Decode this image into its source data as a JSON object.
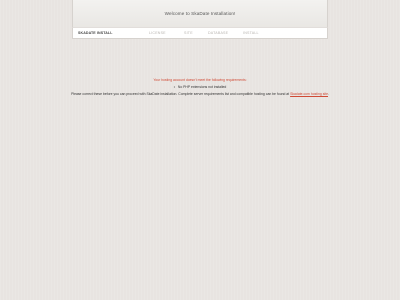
{
  "header": {
    "title": "Welcome to SkaDate Installation!"
  },
  "navbar": {
    "brand": "SKADATE INSTALL",
    "steps": [
      "LICENSE",
      "SITE",
      "DATABASE",
      "INSTALL"
    ]
  },
  "content": {
    "error_title": "Your hosting account doesn't meet the following requirements:",
    "requirements": [
      "No PHP extensions not installed"
    ],
    "note_text": "Please correct these before you can proceed with SkaDate installation. Complete server requirements list and compatible hosting can be found at",
    "note_link": "Skadate.com hosting site",
    "note_end": ".",
    "accent_color": "#d04a35"
  }
}
